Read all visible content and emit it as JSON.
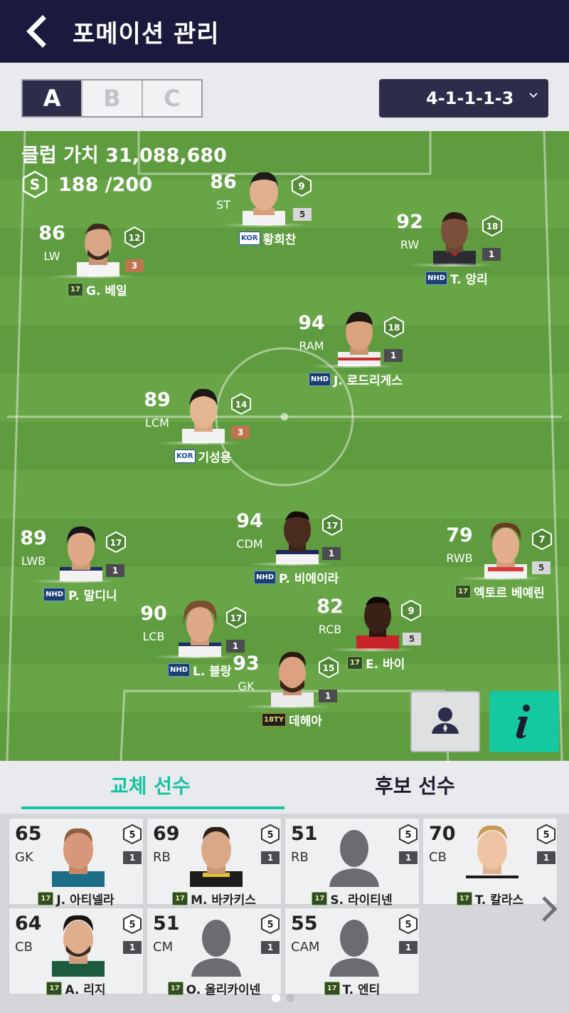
{
  "header": {
    "title": "포메이션 관리"
  },
  "toolbar": {
    "tabs": [
      "A",
      "B",
      "C"
    ],
    "active_tab": "A",
    "formation": "4-1-1-1-3"
  },
  "pitch": {
    "club_value": "클럽 가치 31,088,680",
    "salary_badge": "S",
    "salary": "188 /200"
  },
  "players": [
    {
      "ovr": "86",
      "pos": "ST",
      "level": "9",
      "enh": "5",
      "season": "KOR",
      "name": "황희찬"
    },
    {
      "ovr": "86",
      "pos": "LW",
      "level": "12",
      "enh": "3",
      "season": "17",
      "name": "G. 베일"
    },
    {
      "ovr": "92",
      "pos": "RW",
      "level": "18",
      "enh": "1",
      "season": "NHD",
      "name": "T. 앙리"
    },
    {
      "ovr": "94",
      "pos": "RAM",
      "level": "18",
      "enh": "1",
      "season": "NHD",
      "name": "J. 로드리게스"
    },
    {
      "ovr": "89",
      "pos": "LCM",
      "level": "14",
      "enh": "3",
      "season": "KOR",
      "name": "기성용"
    },
    {
      "ovr": "94",
      "pos": "CDM",
      "level": "17",
      "enh": "1",
      "season": "NHD",
      "name": "P. 비에이라"
    },
    {
      "ovr": "89",
      "pos": "LWB",
      "level": "17",
      "enh": "1",
      "season": "NHD",
      "name": "P. 말디니"
    },
    {
      "ovr": "79",
      "pos": "RWB",
      "level": "7",
      "enh": "5",
      "season": "17",
      "name": "엑토르 베예린"
    },
    {
      "ovr": "90",
      "pos": "LCB",
      "level": "17",
      "enh": "1",
      "season": "NHD",
      "name": "L. 블랑"
    },
    {
      "ovr": "82",
      "pos": "RCB",
      "level": "9",
      "enh": "5",
      "season": "17",
      "name": "E. 바이"
    },
    {
      "ovr": "93",
      "pos": "GK",
      "level": "15",
      "enh": "1",
      "season": "18TY",
      "name": "데헤아"
    }
  ],
  "bottom_tabs": {
    "subs": "교체 선수",
    "reserves": "후보 선수"
  },
  "bench": [
    {
      "ovr": "65",
      "pos": "GK",
      "level": "5",
      "enh": "1",
      "season": "17",
      "name": "J. 아티넬라"
    },
    {
      "ovr": "69",
      "pos": "RB",
      "level": "5",
      "enh": "1",
      "season": "17",
      "name": "M. 바카키스"
    },
    {
      "ovr": "51",
      "pos": "RB",
      "level": "5",
      "enh": "1",
      "season": "17",
      "name": "S. 라이티넨"
    },
    {
      "ovr": "70",
      "pos": "CB",
      "level": "5",
      "enh": "1",
      "season": "17",
      "name": "T. 칼라스"
    },
    {
      "ovr": "64",
      "pos": "CB",
      "level": "5",
      "enh": "1",
      "season": "17",
      "name": "A. 리지"
    },
    {
      "ovr": "51",
      "pos": "CM",
      "level": "5",
      "enh": "1",
      "season": "17",
      "name": "O. 올리카이넨"
    },
    {
      "ovr": "55",
      "pos": "CAM",
      "level": "5",
      "enh": "1",
      "season": "17",
      "name": "T. 엔티"
    }
  ],
  "icons": {
    "back": "chevron-left-icon",
    "dropdown": "chevron-down-icon",
    "manager": "manager-icon",
    "info": "info-icon",
    "next": "chevron-right-icon"
  },
  "colors": {
    "accent": "#17c3a2",
    "header": "#1b1a3e",
    "pitch": "#67a546"
  }
}
